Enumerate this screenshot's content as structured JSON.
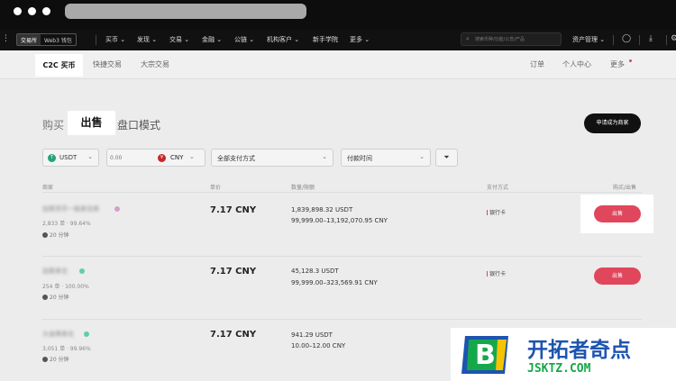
{
  "nav": {
    "segment": [
      "交易所",
      "Web3 钱包"
    ],
    "items": [
      "买币",
      "发现",
      "交易",
      "金融",
      "公链",
      "机构客户",
      "新手学院",
      "更多"
    ],
    "search_placeholder": "搜索币种/功能/公告/产品",
    "asset": "资产管理"
  },
  "subnav": {
    "left": [
      "C2C 买币",
      "快捷交易",
      "大宗交易"
    ],
    "right": [
      "订单",
      "个人中心",
      "更多"
    ]
  },
  "trade_tabs": {
    "buy": "购买",
    "sell": "出售",
    "mode": "盘口模式"
  },
  "merchant_button": "申请成为商家",
  "filters": {
    "coin": "USDT",
    "amount_placeholder": "0.00",
    "currency": "CNY",
    "payment": "全部支付方式",
    "pay_time": "付款时间"
  },
  "table": {
    "headers": [
      "商家",
      "单价",
      "数量/限额",
      "支付方式",
      "购买/出售"
    ],
    "rows": [
      {
        "merchant": "加密货币一级承兑商",
        "stats": "2,833 单 · 99.64%",
        "time": "20 分钟",
        "price": "7.17 CNY",
        "quantity": "1,839,898.32 USDT",
        "limit": "99,999.00–13,192,070.95 CNY",
        "payment": "银行卡",
        "action": "出售"
      },
      {
        "merchant": "加密承兑",
        "stats": "254 单 · 100.00%",
        "time": "20 分钟",
        "price": "7.17 CNY",
        "quantity": "45,128.3 USDT",
        "limit": "99,999.00–323,569.91 CNY",
        "payment": "银行卡",
        "action": "出售"
      },
      {
        "merchant": "大金牌承兑",
        "stats": "3,051 单 · 99.96%",
        "time": "20 分钟",
        "price": "7.17 CNY",
        "quantity": "941.29 USDT",
        "limit": "10.00–12.00 CNY",
        "payment": "",
        "action": ""
      }
    ]
  },
  "watermark": {
    "title": "开拓者奇点",
    "url": "JSKTZ.COM",
    "logo_letter": "B"
  },
  "colors": {
    "accent": "#e0465c",
    "tether": "#26a17b",
    "cny": "#c62828",
    "watermark_blue": "#1d54b0",
    "watermark_green": "#15a84a"
  }
}
